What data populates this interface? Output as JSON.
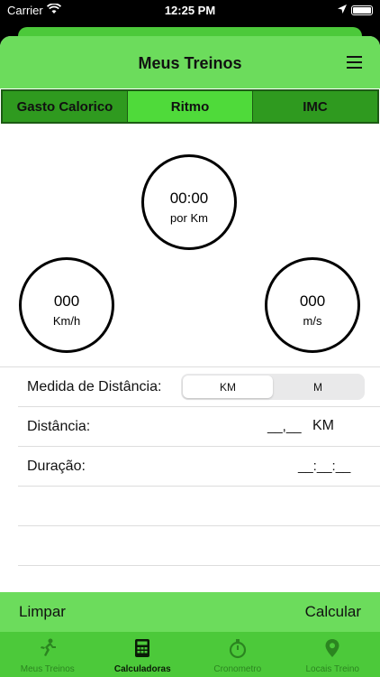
{
  "status": {
    "carrier": "Carrier",
    "time": "12:25 PM"
  },
  "nav": {
    "title": "Meus Treinos"
  },
  "segments": [
    {
      "label": "Gasto Calorico",
      "active": false
    },
    {
      "label": "Ritmo",
      "active": true
    },
    {
      "label": "IMC",
      "active": false
    }
  ],
  "circles": {
    "pace": {
      "value": "00:00",
      "unit": "por Km"
    },
    "kmh": {
      "value": "000",
      "unit": "Km/h"
    },
    "ms": {
      "value": "000",
      "unit": "m/s"
    }
  },
  "form": {
    "distance_measure_label": "Medida de Distância:",
    "units": [
      "KM",
      "M"
    ],
    "selected_unit": "KM",
    "distance_label": "Distância:",
    "distance_value": "__,__",
    "distance_unit": "KM",
    "duration_label": "Duração:",
    "duration_value": "__:__:__"
  },
  "actions": {
    "clear": "Limpar",
    "calculate": "Calcular"
  },
  "tabbar": [
    {
      "label": "Meus Treinos",
      "icon": "runner-icon",
      "active": false
    },
    {
      "label": "Calculadoras",
      "icon": "calculator-icon",
      "active": true
    },
    {
      "label": "Cronometro",
      "icon": "stopwatch-icon",
      "active": false
    },
    {
      "label": "Locais Treino",
      "icon": "location-pin-icon",
      "active": false
    }
  ],
  "colors": {
    "header": "#6cdc5c",
    "segment": "#2f9a1f",
    "segment_active": "#4fda3a",
    "tabbar": "#4cc93a"
  }
}
